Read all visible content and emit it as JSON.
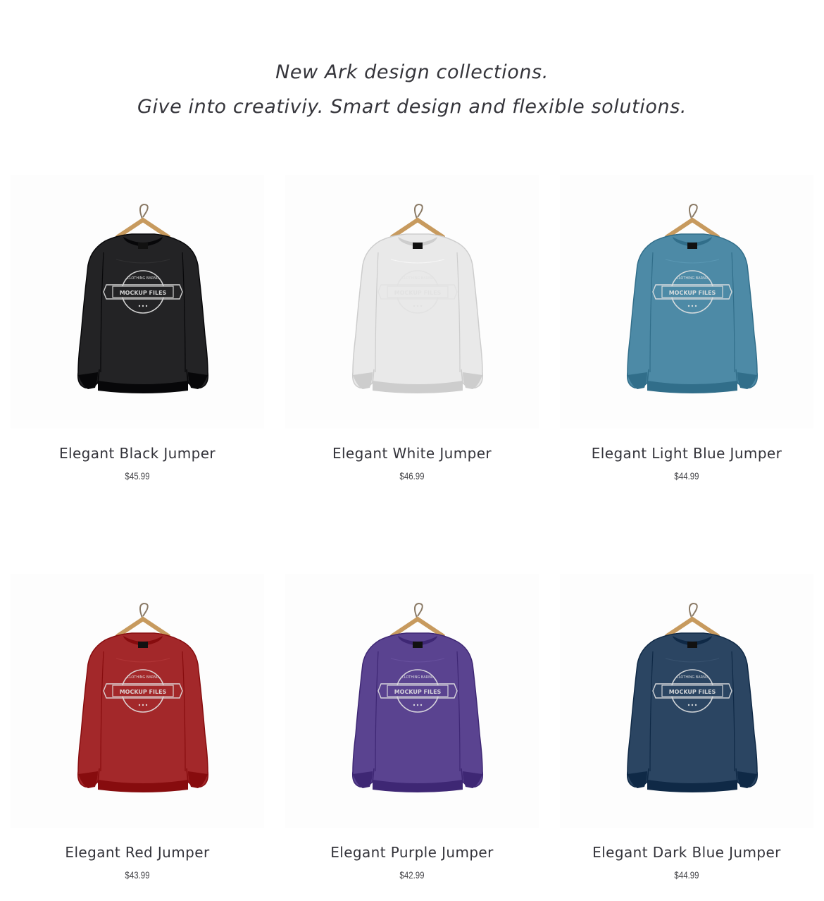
{
  "hero": {
    "line1": "New Ark design collections.",
    "line2": "Give into creativiy. Smart design and flexible solutions."
  },
  "products": [
    {
      "name": "Elegant Black Jumper",
      "price": "$45.99",
      "color": "#232325",
      "icon": "sweater-image",
      "print_text": "MOCKUP FILES"
    },
    {
      "name": "Elegant White Jumper",
      "price": "$46.99",
      "color": "#e9e9e9",
      "icon": "sweater-image",
      "print_text": "MOCKUP FILES"
    },
    {
      "name": "Elegant Light Blue Jumper",
      "price": "$44.99",
      "color": "#4d8aa6",
      "icon": "sweater-image",
      "print_text": "MOCKUP FILES"
    },
    {
      "name": "Elegant Red Jumper",
      "price": "$43.99",
      "color": "#a3282a",
      "icon": "sweater-image",
      "print_text": "MOCKUP FILES"
    },
    {
      "name": "Elegant Purple Jumper",
      "price": "$42.99",
      "color": "#5a4390",
      "icon": "sweater-image",
      "print_text": "MOCKUP FILES"
    },
    {
      "name": "Elegant Dark Blue Jumper",
      "price": "$44.99",
      "color": "#2b4562",
      "icon": "sweater-image",
      "print_text": "MOCKUP FILES"
    }
  ]
}
